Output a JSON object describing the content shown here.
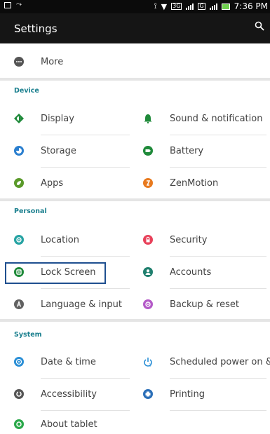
{
  "statusbar": {
    "time": "7:36 PM",
    "network1": "3G",
    "network2": "G"
  },
  "appbar": {
    "title": "Settings",
    "search_icon": "search-icon"
  },
  "more": {
    "label": "More",
    "icon": "more-icon"
  },
  "sections": {
    "device": "Device",
    "personal": "Personal",
    "system": "System"
  },
  "items": {
    "display": {
      "label": "Display",
      "icon": "display-icon"
    },
    "sound": {
      "label": "Sound & notification",
      "icon": "bell-icon"
    },
    "storage": {
      "label": "Storage",
      "icon": "storage-icon"
    },
    "battery": {
      "label": "Battery",
      "icon": "battery-icon"
    },
    "apps": {
      "label": "Apps",
      "icon": "apps-icon"
    },
    "zenmotion": {
      "label": "ZenMotion",
      "icon": "zenmotion-icon"
    },
    "location": {
      "label": "Location",
      "icon": "location-icon"
    },
    "security": {
      "label": "Security",
      "icon": "lock-icon"
    },
    "lockscreen": {
      "label": "Lock Screen",
      "icon": "lock-screen-icon"
    },
    "accounts": {
      "label": "Accounts",
      "icon": "account-icon"
    },
    "language": {
      "label": "Language & input",
      "icon": "language-icon"
    },
    "backup": {
      "label": "Backup & reset",
      "icon": "backup-icon"
    },
    "datetime": {
      "label": "Date & time",
      "icon": "clock-icon"
    },
    "scheduled": {
      "label": "Scheduled power on &..",
      "icon": "power-schedule-icon"
    },
    "accessibility": {
      "label": "Accessibility",
      "icon": "accessibility-icon"
    },
    "printing": {
      "label": "Printing",
      "icon": "printer-icon"
    },
    "about": {
      "label": "About tablet",
      "icon": "info-icon"
    }
  },
  "colors": {
    "teal": "#1a7f8e",
    "highlight_border": "#1f4f8f"
  }
}
